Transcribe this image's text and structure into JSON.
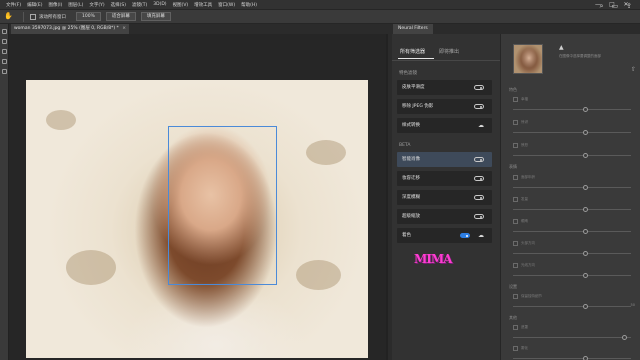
{
  "menu": [
    "文件(F)",
    "编辑(E)",
    "图像(I)",
    "图层(L)",
    "文字(Y)",
    "选择(S)",
    "滤镜(T)",
    "3D(D)",
    "视图(V)",
    "增效工具",
    "窗口(W)",
    "帮助(H)"
  ],
  "window_controls": {
    "minimize": "—",
    "maximize": "□",
    "close": "✕"
  },
  "options_bar": {
    "scroll_all_label": "滚动所有窗口",
    "zoom_value": "100%",
    "fit_screen_label": "适合屏幕",
    "fill_screen_label": "填充屏幕"
  },
  "document_tab": {
    "title": "woman 3597073.jpg @ 25% (图层 0, RGB/8*) *",
    "close": "×"
  },
  "panel": {
    "tab": "Neural Filters",
    "tabs": [
      "所有筛选器",
      "即将推出"
    ],
    "section_featured": "特色滤镜",
    "section_beta": "BETA",
    "featured": [
      {
        "label": "皮肤平滑度",
        "control": "toggle"
      },
      {
        "label": "移除 JPEG 伪影",
        "control": "toggle"
      },
      {
        "label": "样式转换",
        "control": "cloud"
      }
    ],
    "beta": [
      {
        "label": "智能肖像",
        "control": "toggle",
        "active": true
      },
      {
        "label": "妆容迁移",
        "control": "toggle"
      },
      {
        "label": "深度模糊",
        "control": "toggle"
      },
      {
        "label": "超级缩放",
        "control": "toggle"
      },
      {
        "label": "着色",
        "control": "toggle-on"
      }
    ],
    "stamp_text": "MIMA"
  },
  "settings": {
    "warn_icon": "▲",
    "thumb_text": "在图像中选择要调整的面部",
    "scroll_icon": "⇧",
    "section_featured": "特色",
    "features": [
      "幸福",
      "惊讶",
      "愤怒"
    ],
    "section_expression": "表情",
    "expressions": [
      "面部年龄",
      "发量",
      "眼睛",
      "头部方向",
      "光线方向"
    ],
    "section_settings": "设置",
    "lighting": "保留独特细节",
    "section_other": "其他",
    "other": [
      "遮罩",
      "雾化"
    ],
    "end_value": "50",
    "knob_positions": [
      0.62,
      0.62,
      0.62,
      0.62,
      0.62,
      0.62,
      0.62,
      0.62,
      0.62,
      0.95,
      0.62,
      0.25
    ]
  }
}
